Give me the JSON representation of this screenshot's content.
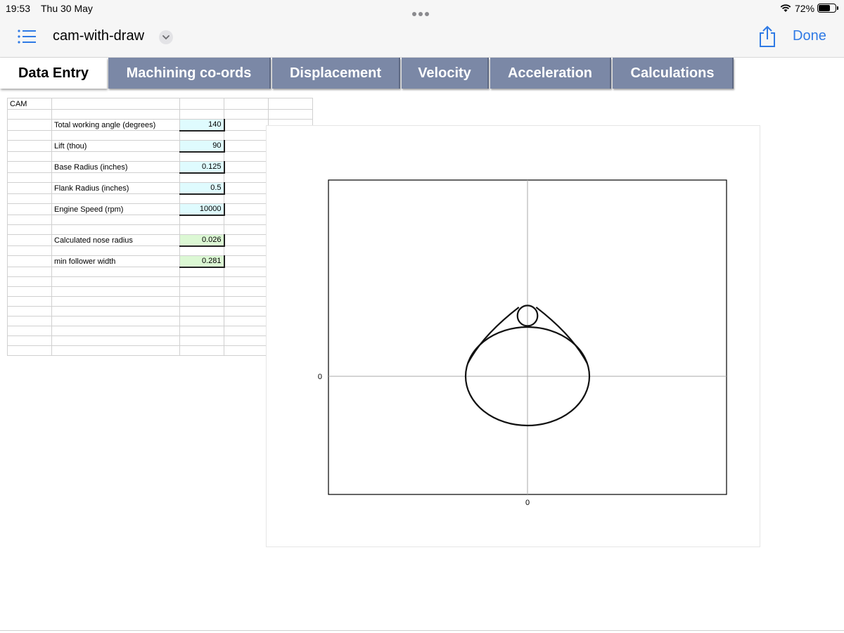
{
  "status": {
    "time": "19:53",
    "date": "Thu 30 May",
    "battery_pct": "72%",
    "battery_level": 0.72
  },
  "nav": {
    "doc_title": "cam-with-draw",
    "done_label": "Done",
    "icons": [
      "list-icon",
      "chevron-down-icon",
      "share-icon"
    ]
  },
  "tabs": [
    {
      "label": "Data Entry",
      "active": true
    },
    {
      "label": "Machining co-ords",
      "active": false
    },
    {
      "label": "Displacement",
      "active": false
    },
    {
      "label": "Velocity",
      "active": false
    },
    {
      "label": "Acceleration",
      "active": false
    },
    {
      "label": "Calculations",
      "active": false
    }
  ],
  "sheet": {
    "title": "CAM",
    "rows": [
      {
        "label": "Total working angle (degrees)",
        "value": "140",
        "kind": "input"
      },
      {
        "label": "Lift (thou)",
        "value": "90",
        "kind": "input"
      },
      {
        "label": "Base Radius (inches)",
        "value": "0.125",
        "kind": "input"
      },
      {
        "label": "Flank Radius (inches)",
        "value": "0.5",
        "kind": "input"
      },
      {
        "label": "Engine Speed (rpm)",
        "value": "10000",
        "kind": "input"
      },
      {
        "label": "Calculated nose radius",
        "value": "0.026",
        "kind": "calc"
      },
      {
        "label": "min follower width",
        "value": "0.281",
        "kind": "calc"
      }
    ]
  },
  "colors": {
    "tab_bg": "#7b88a6",
    "input_bg": "#dffbfe",
    "calc_bg": "#dcf8d4",
    "accent": "#2f7ae5"
  },
  "chart_data": {
    "type": "line",
    "title": "",
    "xlabel": "",
    "ylabel": "",
    "x_tick_labels": [
      "0"
    ],
    "y_tick_labels": [
      "0"
    ],
    "grid": false,
    "series": [
      {
        "shape": "base-circle",
        "center": [
          0,
          0
        ],
        "radius": 0.125
      },
      {
        "shape": "nose-circle",
        "center": [
          0,
          0.161
        ],
        "radius": 0.026
      },
      {
        "shape": "flank-left"
      },
      {
        "shape": "flank-right"
      }
    ]
  }
}
